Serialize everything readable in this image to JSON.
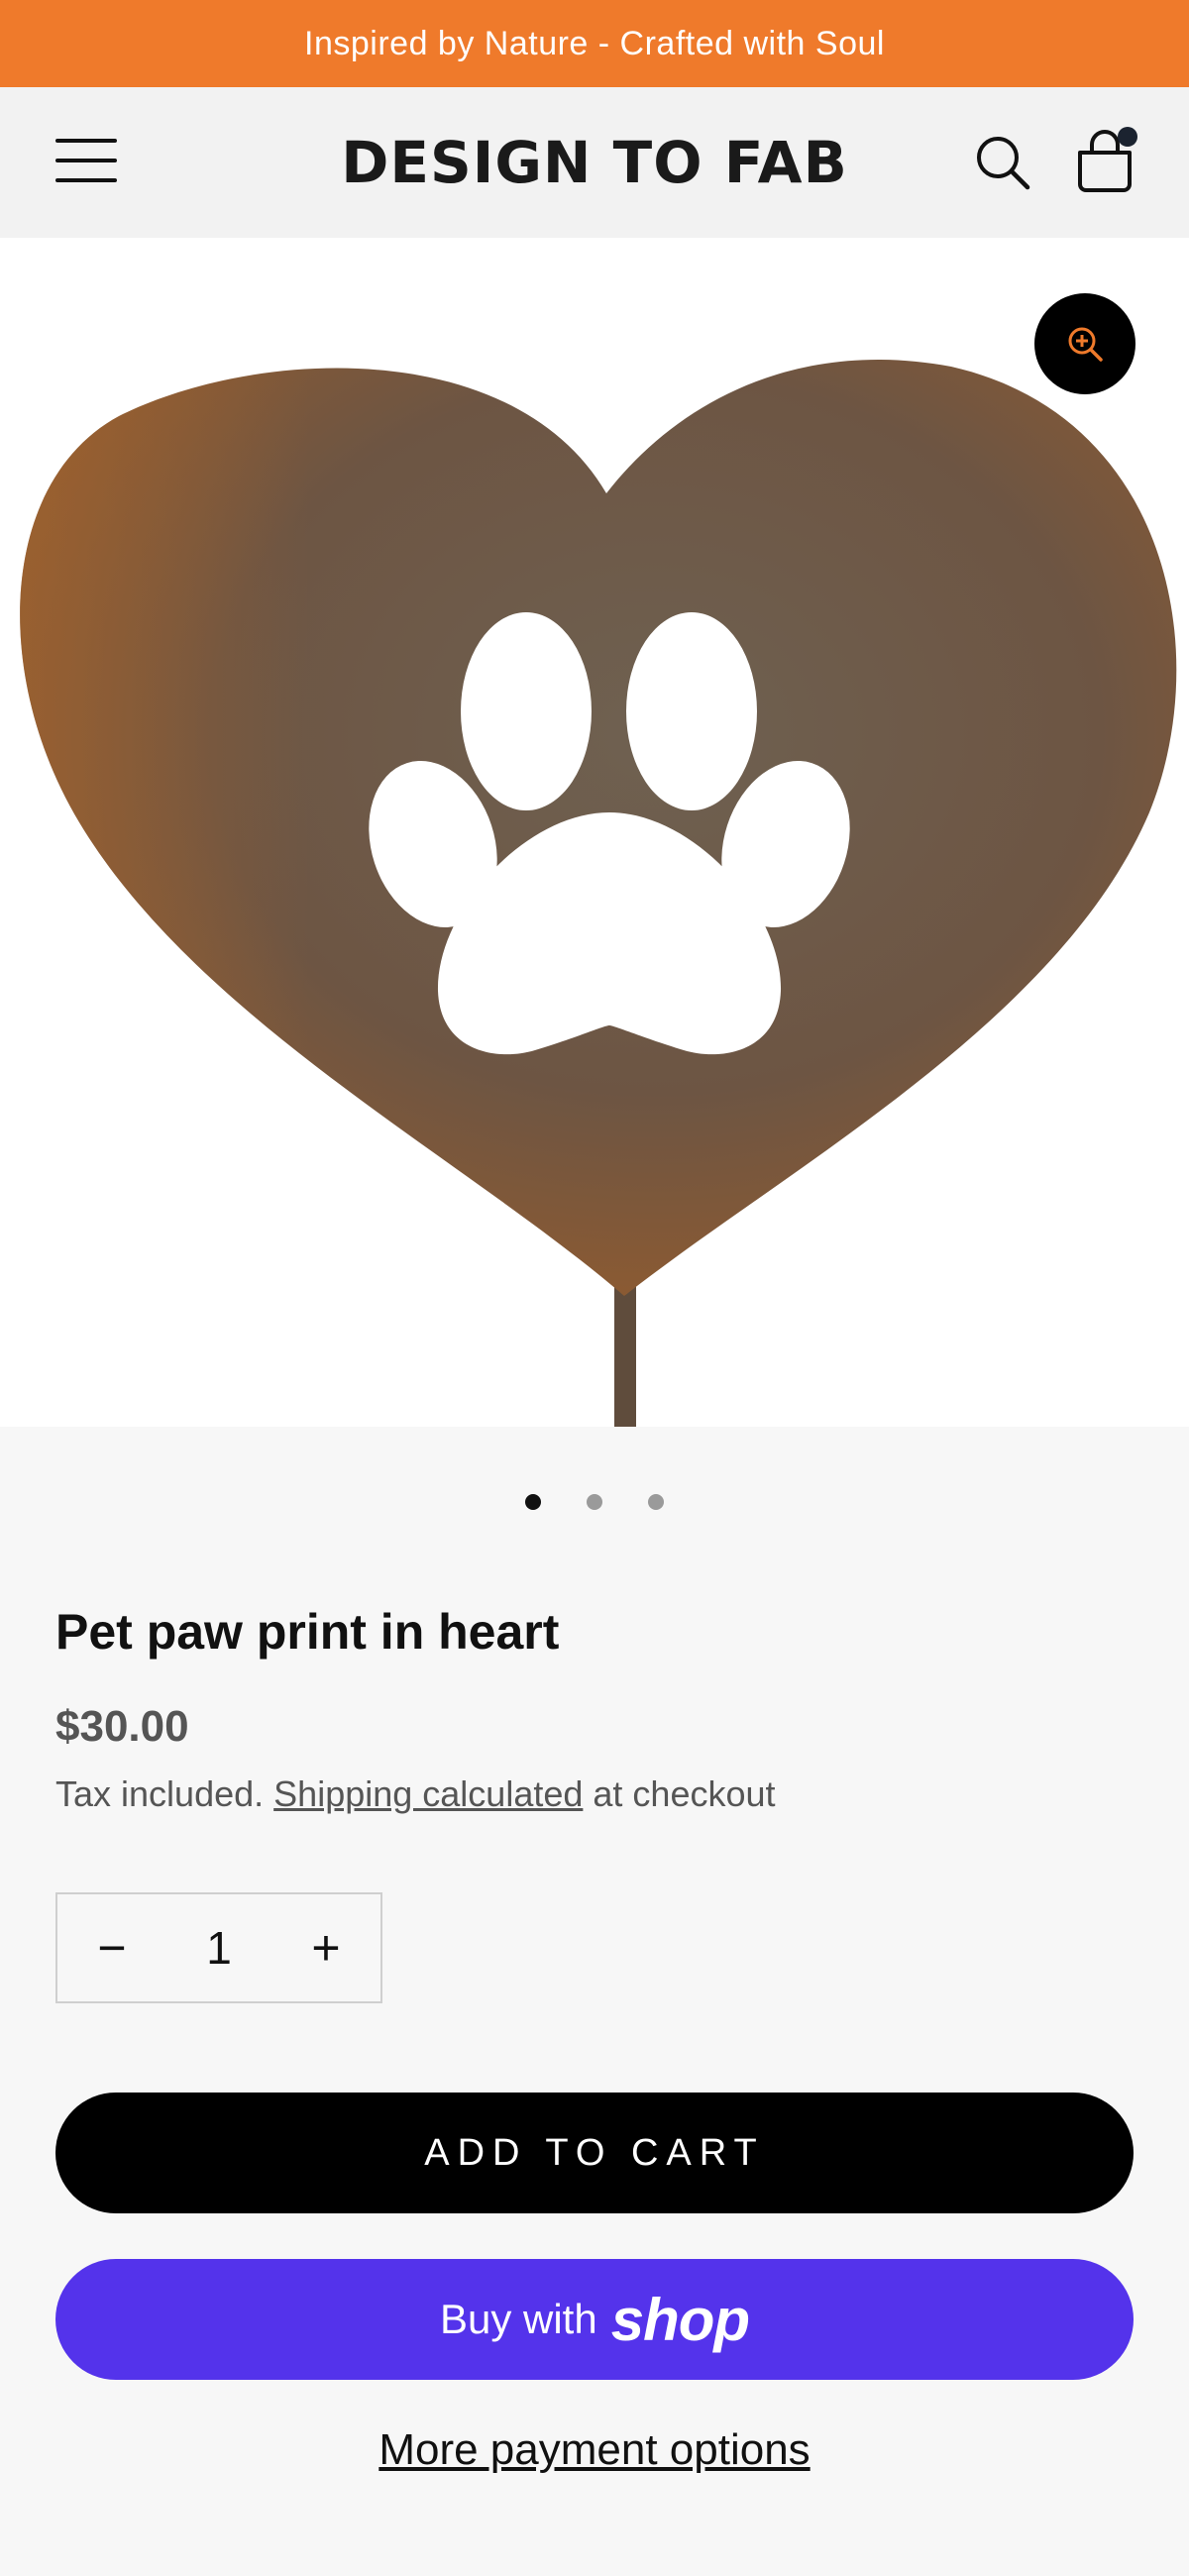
{
  "announcement": {
    "text": "Inspired by Nature - Crafted with Soul"
  },
  "header": {
    "logo": "DESIGN TO FAB",
    "menu_icon": "hamburger-menu-icon",
    "search_icon": "search-icon",
    "cart_icon": "shopping-bag-icon"
  },
  "gallery": {
    "zoom_icon": "zoom-in-icon",
    "slide_count": 3,
    "active_slide": 1
  },
  "product": {
    "title": "Pet paw print in heart",
    "price": "$30.00",
    "tax_prefix": "Tax included.",
    "shipping_link": "Shipping calculated",
    "tax_suffix": "at checkout"
  },
  "quantity": {
    "minus": "−",
    "value": "1",
    "plus": "+"
  },
  "buttons": {
    "add_to_cart": "ADD TO CART",
    "buy_with": "Buy with",
    "shop": "shop",
    "more_payment_options": "More payment options"
  },
  "colors": {
    "announcement_bg": "#ef7a2b",
    "header_bg": "#f2f2f2",
    "shop_pay_purple": "#5433eb",
    "rust": "#6e5744"
  }
}
